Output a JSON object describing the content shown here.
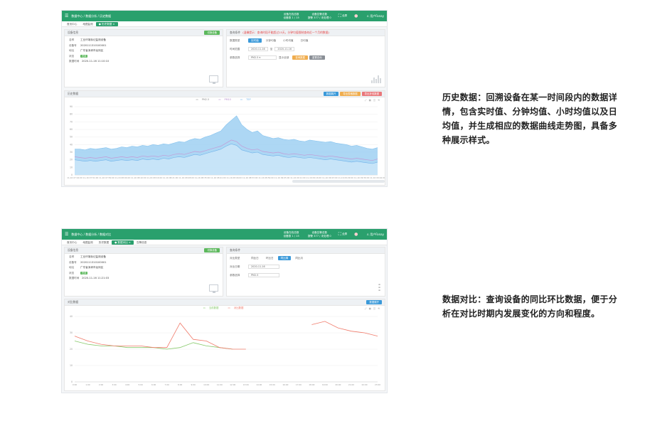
{
  "screen1": {
    "topbar": {
      "breadcrumb": "数据中心 / 数据分析 / 历史数据",
      "stat1_top": "设备在线总数",
      "stat1_val": "设备数 1 / 15",
      "stat2_top": "设备告警总数",
      "stat2_val": "报警 377 / 未处理 0",
      "fullscreen": "全屏",
      "user": "用户Fanay"
    },
    "tabs": [
      "首页中心",
      "地图监测",
      "● 历史数据 ×"
    ],
    "device_panel": {
      "title": "设备信息",
      "button": "切换设备",
      "rows": [
        {
          "k": "名称",
          "v": "工业环境标记监测设备"
        },
        {
          "k": "设备号",
          "v": "2020111310100001"
        },
        {
          "k": "地址",
          "v": "广东省深圳市龙岗区"
        },
        {
          "k": "状态",
          "v": "在线"
        },
        {
          "k": "数据时间",
          "v": "2020-11-16 11:10:10"
        }
      ]
    },
    "query_panel": {
      "title": "查询条件",
      "warn": "(温馨提示：查询时段不能超过15天，分钟均值限制查询近一个月的数据)",
      "rows": [
        {
          "k": "数据类型",
          "segments": [
            "实时值",
            "分钟均值",
            "小时均值",
            "日均值"
          ]
        },
        {
          "k": "时间范围",
          "from": "2020-11-16",
          "sep": "至",
          "to": "2020-11-16"
        },
        {
          "k": "参数选择",
          "param": "PM2.5 ▾",
          "label": "显示全部",
          "buttons": [
            "查询数据",
            "重置查询"
          ]
        }
      ]
    },
    "chart_panel": {
      "title": "历史数据",
      "buttons": [
        "数据展开",
        "导出表格数据",
        "导出折线数据"
      ],
      "legend": [
        "PM2.5",
        "PM10",
        "TSP"
      ]
    }
  },
  "screen2": {
    "topbar": {
      "breadcrumb": "数据中心 / 数据分析 / 数据对比",
      "stat1_top": "设备在线总数",
      "stat1_val": "设备数 1 / 15",
      "stat2_top": "设备告警总数",
      "stat2_val": "报警 377 / 未处理 0",
      "fullscreen": "全屏",
      "user": "用户Fanay"
    },
    "tabs": [
      "首页中心",
      "地图监测",
      "历史数据",
      "● 数据对比 ×",
      "告警信息"
    ],
    "device_panel": {
      "title": "设备信息",
      "button": "切换设备",
      "rows": [
        {
          "k": "名称",
          "v": "工业环境标记监测设备"
        },
        {
          "k": "设备号",
          "v": "2020111310100001"
        },
        {
          "k": "地址",
          "v": "广东省深圳市龙岗区"
        },
        {
          "k": "状态",
          "v": "在线"
        },
        {
          "k": "数据时间",
          "v": "2020-11-16 11:21:03"
        }
      ]
    },
    "query_panel": {
      "title": "查询条件",
      "rows": [
        {
          "k": "对比类型",
          "segments": [
            "同比日",
            "环比日",
            "同比周",
            "同比月"
          ]
        },
        {
          "k": "对比日期",
          "from": "2020-11-16"
        },
        {
          "k": "参数选择",
          "param": "PM2.5"
        }
      ]
    },
    "chart_panel": {
      "title": "对比数据",
      "button": "数据展开",
      "legend": [
        "当前数据",
        "对比数据"
      ]
    }
  },
  "captions": {
    "c1": "历史数据：回溯设备在某一时间段内的数据详情，包含实时值、分钟均值、小时均值以及日均值，并生成相应的数据曲线走势图，具备多种展示样式。",
    "c2": "数据对比：查询设备的同比环比数据，便于分析在对比时期内发展变化的方向和程度。"
  },
  "colors": {
    "brand": "#2aa06d",
    "blue": "#3a99d9",
    "area_fill": "#9fd0f2",
    "pm10": "#c39ad6",
    "tsp": "#6fb3ea",
    "cmp_red": "#f07a6a",
    "cmp_green": "#86c96a"
  },
  "chart_data": [
    {
      "type": "area",
      "title": "",
      "legend": [
        "PM2.5",
        "PM10",
        "TSP"
      ],
      "ylim": [
        0,
        90
      ],
      "yticks": [
        0,
        10,
        20,
        30,
        40,
        50,
        60,
        70,
        80,
        90
      ],
      "x_ticks": [
        "11-16 07:44:00",
        "11-16 07:51:00",
        "11-16 07:59:00",
        "11-16 08:04:00",
        "11-16 08:10:00",
        "11-16 08:16:00",
        "11-16 08:21:00",
        "11-16 08:28:00",
        "11-16 08:35:00",
        "11-16 08:41:00",
        "11-16 08:46:00",
        "11-16 08:53:00",
        "11-16 08:59:00",
        "11-16 09:05:00",
        "11-16 09:11:00",
        "11-16 09:16:00",
        "11-16 09:23:00",
        "11-16 09:29:00",
        "11-16 09:36:00",
        "11-16 09:42:00"
      ],
      "series": [
        {
          "name": "PM2.5",
          "values": [
            34,
            34,
            33,
            35,
            34,
            35,
            36,
            34,
            35,
            37,
            36,
            38,
            37,
            39,
            38,
            40,
            39,
            41,
            40,
            42,
            44,
            43,
            46,
            48,
            47,
            50,
            52,
            55,
            58,
            66,
            72,
            78,
            66,
            60,
            56,
            58,
            52,
            50,
            48,
            49,
            47,
            46,
            47,
            45,
            44,
            46,
            45,
            44,
            43,
            44,
            42,
            41,
            40,
            38,
            39,
            37,
            35,
            34,
            36
          ]
        },
        {
          "name": "PM10",
          "values": [
            24,
            23,
            22,
            23,
            22,
            23,
            24,
            22,
            23,
            24,
            23,
            24,
            23,
            25,
            24,
            25,
            24,
            26,
            25,
            27,
            28,
            27,
            29,
            31,
            30,
            32,
            34,
            36,
            38,
            42,
            46,
            44,
            38,
            35,
            33,
            34,
            31,
            30,
            29,
            30,
            28,
            27,
            28,
            27,
            26,
            27,
            26,
            25,
            24,
            25,
            24,
            23,
            22,
            21,
            22,
            21,
            20,
            19,
            21
          ]
        },
        {
          "name": "TSP",
          "values": [
            20,
            19,
            18,
            19,
            18,
            19,
            20,
            18,
            19,
            20,
            19,
            20,
            19,
            21,
            20,
            21,
            20,
            22,
            21,
            23,
            24,
            23,
            25,
            27,
            26,
            28,
            30,
            32,
            34,
            38,
            41,
            39,
            33,
            31,
            29,
            30,
            27,
            26,
            25,
            26,
            24,
            23,
            24,
            23,
            22,
            23,
            22,
            21,
            20,
            21,
            20,
            19,
            18,
            17,
            18,
            17,
            16,
            15,
            17
          ]
        }
      ]
    },
    {
      "type": "line",
      "title": "",
      "legend": [
        "当前数据",
        "对比数据"
      ],
      "ylim": [
        0,
        40
      ],
      "yticks": [
        0,
        10,
        20,
        30,
        40
      ],
      "x_ticks": [
        "0:00",
        "1:00",
        "2:00",
        "3:00",
        "4:00",
        "5:00",
        "6:00",
        "7:00",
        "8:00",
        "9:00",
        "10:00",
        "11:00",
        "12:00",
        "13:00",
        "14:00",
        "15:00",
        "16:00",
        "17:00",
        "18:00",
        "19:00",
        "20:00",
        "21:00",
        "22:00",
        "23:00"
      ],
      "series": [
        {
          "name": "当前数据",
          "values": [
            25,
            23,
            22,
            22,
            21,
            21,
            21,
            20,
            21,
            24,
            22,
            21,
            20,
            null,
            null,
            null,
            null,
            null,
            null,
            null,
            null,
            null,
            null,
            null
          ]
        },
        {
          "name": "对比数据",
          "values": [
            28,
            25,
            23,
            22,
            22,
            22,
            21,
            21,
            36,
            26,
            25,
            21,
            20,
            20,
            null,
            null,
            null,
            null,
            35,
            37,
            33,
            31,
            30,
            28
          ]
        }
      ]
    }
  ]
}
